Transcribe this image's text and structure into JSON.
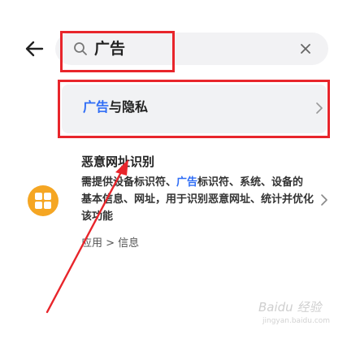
{
  "search": {
    "query": "广告",
    "clear_glyph": "×"
  },
  "result": {
    "keyword": "广告",
    "rest": "与隐私",
    "chevron": "›"
  },
  "item": {
    "title": "恶意网址识别",
    "desc_before": "需提供设备标识符、",
    "desc_keyword": "广告",
    "desc_after": "标识符、系统、设备的基本信息、网址，用于识别恶意网址、统计并优化该功能",
    "path": "应用 > 信息",
    "chevron": "›"
  },
  "watermark": {
    "brand": "Baidu 经验",
    "url": "jingyan.baidu.com"
  },
  "colors": {
    "highlight": "#e8252b",
    "keyword_blue": "#2f6df6",
    "app_icon": "#f5a623",
    "search_bg": "#f2f2f4"
  },
  "icons": [
    "back-arrow-icon",
    "search-icon",
    "clear-icon",
    "chevron-right-icon",
    "app-grid-icon"
  ]
}
